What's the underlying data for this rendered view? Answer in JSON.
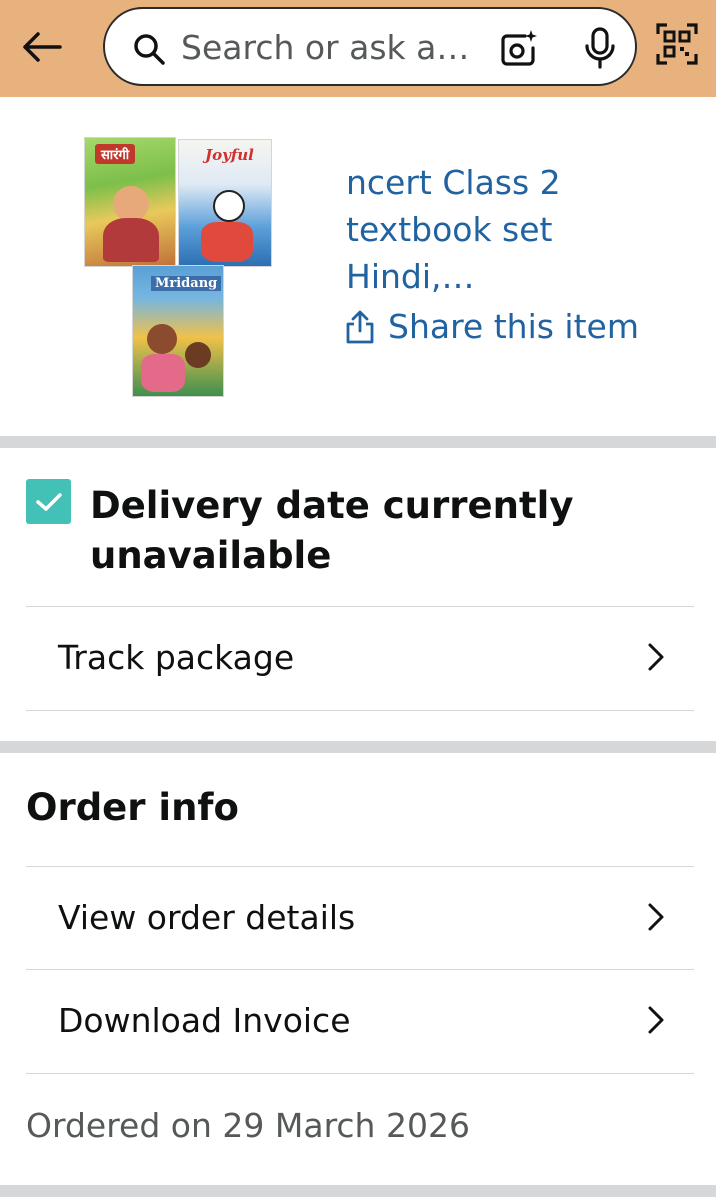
{
  "header": {
    "search_placeholder": "Search or ask a…",
    "background_color": "#e8b27e",
    "icons": [
      "back-arrow-icon",
      "search-icon",
      "camera-lens-icon",
      "microphone-icon",
      "qr-scan-icon"
    ]
  },
  "product": {
    "title": "ncert Class 2 textbook set Hindi,…",
    "share_label": "Share this item",
    "link_color": "#2162a1",
    "books": [
      {
        "cover_text": "सारंगी"
      },
      {
        "cover_text": "Joyful"
      },
      {
        "cover_text": "Mridang"
      }
    ]
  },
  "delivery": {
    "status": "Delivery date currently unavailable",
    "checkbox_color": "#43c1b6",
    "track_label": "Track package"
  },
  "order_info": {
    "title": "Order info",
    "items": [
      {
        "label": "View order details"
      },
      {
        "label": "Download Invoice"
      }
    ],
    "ordered_on": "Ordered on 29 March 2026"
  }
}
